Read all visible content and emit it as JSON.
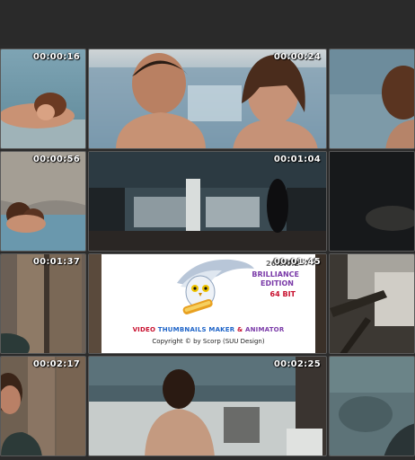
{
  "thumbnails": [
    {
      "timestamp": "00:00:16"
    },
    {
      "timestamp": "00:00:24"
    },
    {
      "timestamp": "00:00:56"
    },
    {
      "timestamp": "00:01:04"
    },
    {
      "timestamp": "00:01:37"
    },
    {
      "timestamp": "00:01:45"
    },
    {
      "timestamp": "00:02:17"
    },
    {
      "timestamp": "00:02:25"
    }
  ],
  "logo": {
    "version": "26.0.0.2",
    "edition_line1": "BRILLIANCE",
    "edition_line2": "EDITION",
    "bits": "64 BIT",
    "title_part1": "VIDEO ",
    "title_part2": "THUMBNAILS MAKER",
    "title_part3": " & ",
    "title_part4": "ANIMATOR",
    "copyright": "Copyright © by Scorp (SUU Design)"
  },
  "colors": {
    "background": "#2b2b2b",
    "cell_border": "#5a5a5a",
    "logo_red": "#c8102e",
    "logo_blue": "#1e64c8",
    "logo_purple": "#7a3aa8"
  }
}
